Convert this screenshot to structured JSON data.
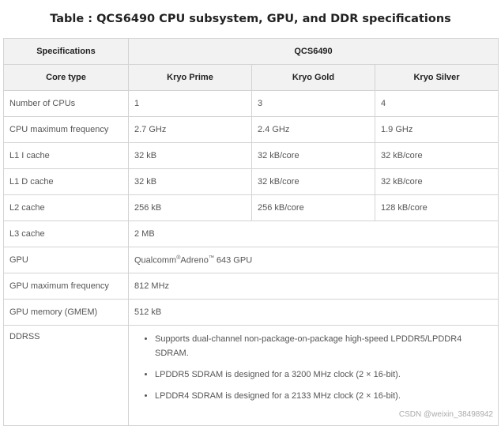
{
  "title": "Table : QCS6490 CPU subsystem, GPU, and DDR specifications",
  "header": {
    "spec_label": "Specifications",
    "product": "QCS6490",
    "core_type_label": "Core type",
    "cores": [
      "Kryo Prime",
      "Kryo Gold",
      "Kryo Silver"
    ]
  },
  "rows": {
    "cpus": {
      "label": "Number of CPUs",
      "v1": "1",
      "v2": "3",
      "v3": "4"
    },
    "freq": {
      "label": "CPU maximum frequency",
      "v1": "2.7 GHz",
      "v2": "2.4 GHz",
      "v3": "1.9 GHz"
    },
    "l1i": {
      "label": "L1 I cache",
      "v1": "32 kB",
      "v2": "32 kB/core",
      "v3": "32 kB/core"
    },
    "l1d": {
      "label": "L1 D cache",
      "v1": "32 kB",
      "v2": "32 kB/core",
      "v3": "32 kB/core"
    },
    "l2": {
      "label": "L2 cache",
      "v1": "256 kB",
      "v2": "256 kB/core",
      "v3": "128 kB/core"
    },
    "l3": {
      "label": "L3 cache",
      "value": "2 MB"
    },
    "gpu": {
      "label": "GPU",
      "brand": "Qualcomm",
      "reg": "®",
      "name": "Adreno",
      "tm": "™",
      "model": " 643 GPU"
    },
    "gpu_freq": {
      "label": "GPU maximum frequency",
      "value": "812 MHz"
    },
    "gmem": {
      "label": "GPU memory (GMEM)",
      "value": "512 kB"
    },
    "ddrss": {
      "label": "DDRSS",
      "items": [
        "Supports dual-channel non-package-on-package high-speed LPDDR5/LPDDR4 SDRAM.",
        "LPDDR5 SDRAM is designed for a 3200 MHz clock (2 × 16-bit).",
        "LPDDR4 SDRAM is designed for a 2133 MHz clock (2 × 16-bit)."
      ]
    }
  },
  "watermark": "CSDN @weixin_38498942"
}
